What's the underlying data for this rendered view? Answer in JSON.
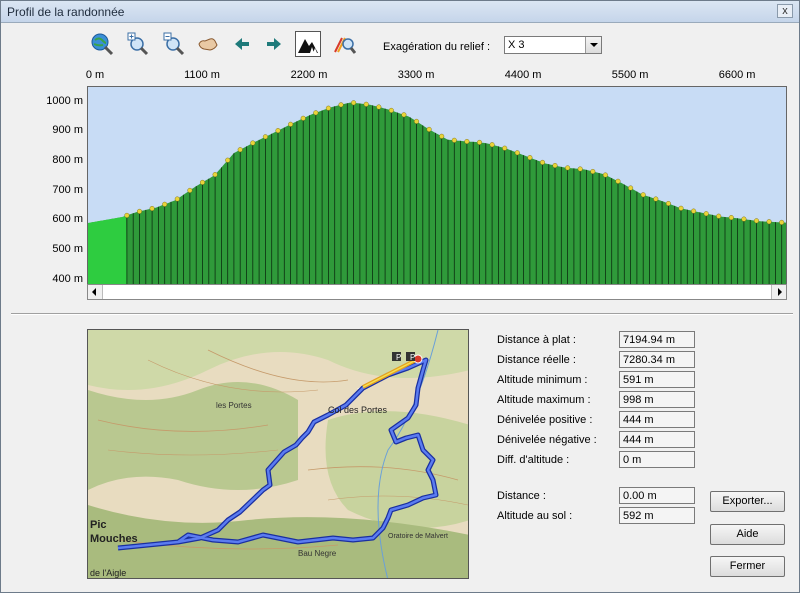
{
  "window": {
    "title": "Profil de la randonnée",
    "close_glyph": "x"
  },
  "toolbar": {
    "buttons": [
      {
        "name": "globe-zoom-icon"
      },
      {
        "name": "zoom-in-icon"
      },
      {
        "name": "zoom-out-icon"
      },
      {
        "name": "hand-pan-icon"
      },
      {
        "name": "arrow-left-icon"
      },
      {
        "name": "arrow-right-icon"
      },
      {
        "name": "relief-terrain-icon",
        "active": true
      },
      {
        "name": "route-zoom-icon"
      }
    ],
    "exaggeration_label": "Exagération du relief :",
    "exaggeration_value": "X 3"
  },
  "chart_data": {
    "type": "area",
    "x_ticks": [
      "0 m",
      "1100 m",
      "2200 m",
      "3300 m",
      "4400 m",
      "5500 m",
      "6600 m"
    ],
    "y_ticks": [
      "1000 m",
      "900 m",
      "800 m",
      "700 m",
      "600 m",
      "500 m",
      "400 m"
    ],
    "xlabel": "",
    "ylabel": "",
    "xlim": [
      0,
      7194.94
    ],
    "ylim": [
      375,
      1050
    ],
    "series": [
      {
        "x": [
          0,
          350,
          500,
          700,
          900,
          1100,
          1300,
          1500,
          1700,
          1900,
          2100,
          2300,
          2500,
          2700,
          2900,
          3100,
          3300,
          3500,
          3700,
          3900,
          4000,
          4100,
          4300,
          4500,
          4700,
          4900,
          5100,
          5300,
          5500,
          5700,
          5900,
          6100,
          6300,
          6500,
          6700,
          6900,
          7194.94
        ],
        "y": [
          591,
          611,
          628,
          643,
          668,
          713,
          752,
          827,
          862,
          894,
          927,
          958,
          982,
          998,
          990,
          973,
          950,
          908,
          872,
          866,
          864,
          860,
          842,
          817,
          792,
          778,
          772,
          756,
          723,
          687,
          665,
          640,
          626,
          613,
          606,
          597,
          592
        ]
      }
    ],
    "colors": {
      "sky": "#c8dcf5",
      "terrain": "#2f9a3a",
      "terrain_start": "#2ecc40",
      "markers": "#e8d43a"
    }
  },
  "stats": {
    "distance_plat_label": "Distance à plat :",
    "distance_plat": "7194.94 m",
    "distance_reelle_label": "Distance réelle :",
    "distance_reelle": "7280.34 m",
    "alt_min_label": "Altitude minimum :",
    "alt_min": "591 m",
    "alt_max_label": "Altitude maximum :",
    "alt_max": "998 m",
    "den_pos_label": "Dénivelée positive :",
    "den_pos": "444 m",
    "den_neg_label": "Dénivelée négative :",
    "den_neg": "444 m",
    "diff_alt_label": "Diff. d'altitude :",
    "diff_alt": "0 m",
    "distance_label": "Distance :",
    "distance": "0.00 m",
    "alt_sol_label": "Altitude au sol :",
    "alt_sol": "592 m"
  },
  "buttons": {
    "exporter": "Exporter...",
    "aide": "Aide",
    "fermer": "Fermer"
  },
  "map": {
    "labels": [
      "Col des Portes",
      "les Portes",
      "Pic",
      "Mouches",
      "Bau Negre",
      "Oratoire de Malvert",
      "de l'Aigle"
    ],
    "route_color": "#2a52e8"
  }
}
